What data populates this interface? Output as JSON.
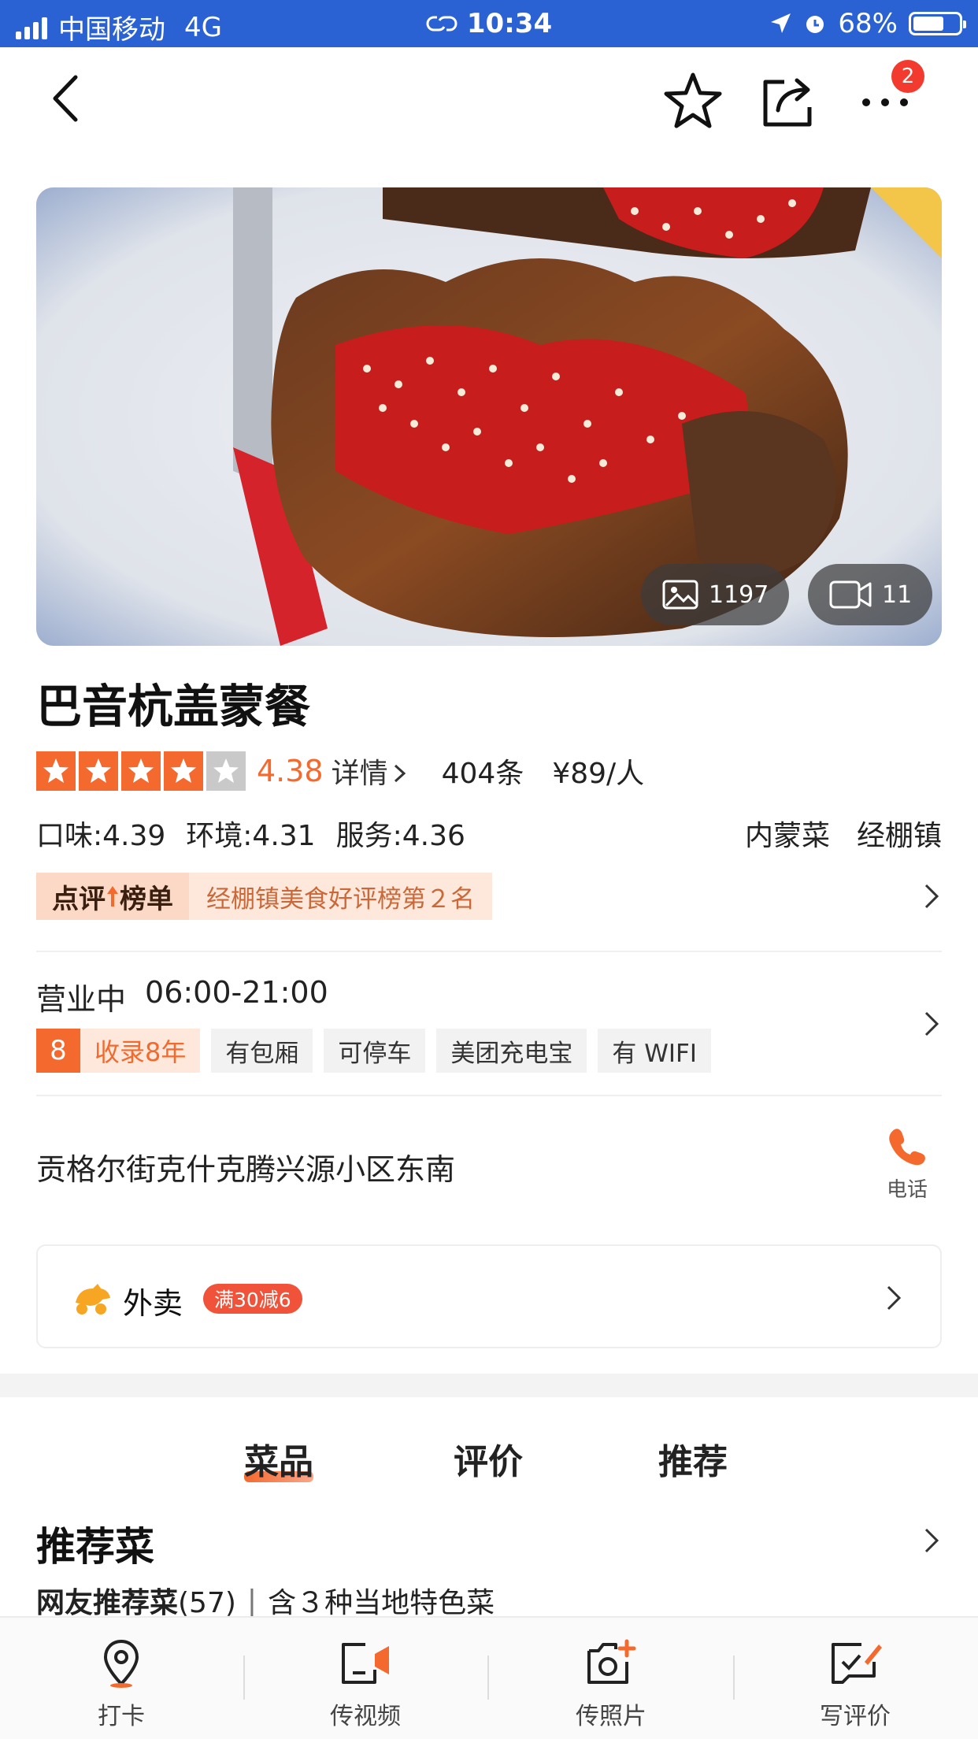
{
  "status_bar": {
    "carrier": "中国移动",
    "network": "4G",
    "time": "10:34",
    "battery": "68%",
    "battery_level": 0.68
  },
  "navbar": {
    "back_icon": "chevron-left-icon",
    "favorite_icon": "star-outline-icon",
    "share_icon": "share-icon",
    "more_icon": "more-dots-icon",
    "more_badge": "2"
  },
  "hero": {
    "photo_count": "1197",
    "video_count": "11"
  },
  "shop": {
    "name": "巴音杭盖蒙餐",
    "rating_stars": 4,
    "score": "4.38",
    "details_label": "详情",
    "review_count": "404条",
    "price": "¥89/人",
    "sub_scores": {
      "taste": "口味:4.39",
      "environment": "环境:4.31",
      "service": "服务:4.36"
    },
    "cuisine": "内蒙菜",
    "area": "经棚镇",
    "rank_tag_pre": "点评",
    "rank_tag_post": "榜单",
    "rank_text": "经棚镇美食好评榜第２名"
  },
  "business": {
    "status": "营业中",
    "hours": "06:00-21:00",
    "years_number": "8",
    "years_label": "收录8年",
    "tags": [
      "有包厢",
      "可停车",
      "美团充电宝",
      "有 WIFI"
    ]
  },
  "address": {
    "text": "贡格尔街克什克腾兴源小区东南",
    "phone_label": "电话"
  },
  "delivery": {
    "title": "外卖",
    "promo": "满30减6"
  },
  "tabs": [
    "菜品",
    "评价",
    "推荐"
  ],
  "recommend": {
    "title": "推荐菜",
    "line_main": "网友推荐菜",
    "line_count": "(57)",
    "line_sep": "|",
    "line_extra": "含３种当地特色菜"
  },
  "bottom_bar": [
    {
      "label": "打卡",
      "icon": "location-pin-icon"
    },
    {
      "label": "传视频",
      "icon": "upload-video-icon"
    },
    {
      "label": "传照片",
      "icon": "upload-photo-icon"
    },
    {
      "label": "写评价",
      "icon": "write-review-icon"
    }
  ],
  "colors": {
    "accent": "#f4692e",
    "status_bar": "#2a62d4",
    "badge": "#f23b2e"
  }
}
